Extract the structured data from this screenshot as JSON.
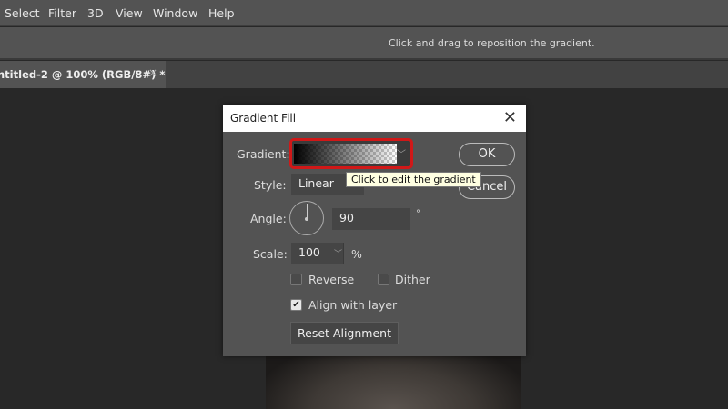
{
  "menu": [
    "Select",
    "Filter",
    "3D",
    "View",
    "Window",
    "Help"
  ],
  "options_hint": "Click and drag to reposition the gradient.",
  "doc_tab": {
    "title": "ntitled-2 @ 100% (RGB/8#) *",
    "close": "×"
  },
  "dialog": {
    "title": "Gradient Fill",
    "close": "✕",
    "gradient_label": "Gradient:",
    "tooltip": "Click to edit the gradient",
    "style_label": "Style:",
    "style_value": "Linear",
    "angle_label": "Angle:",
    "angle_value": "90",
    "angle_unit": "°",
    "scale_label": "Scale:",
    "scale_value": "100",
    "scale_unit": "%",
    "reverse": {
      "label": "Reverse",
      "checked": false
    },
    "dither": {
      "label": "Dither",
      "checked": false
    },
    "align": {
      "label": "Align with layer",
      "checked": true
    },
    "reset_button": "Reset Alignment",
    "ok_button": "OK",
    "cancel_button": "Cancel"
  }
}
